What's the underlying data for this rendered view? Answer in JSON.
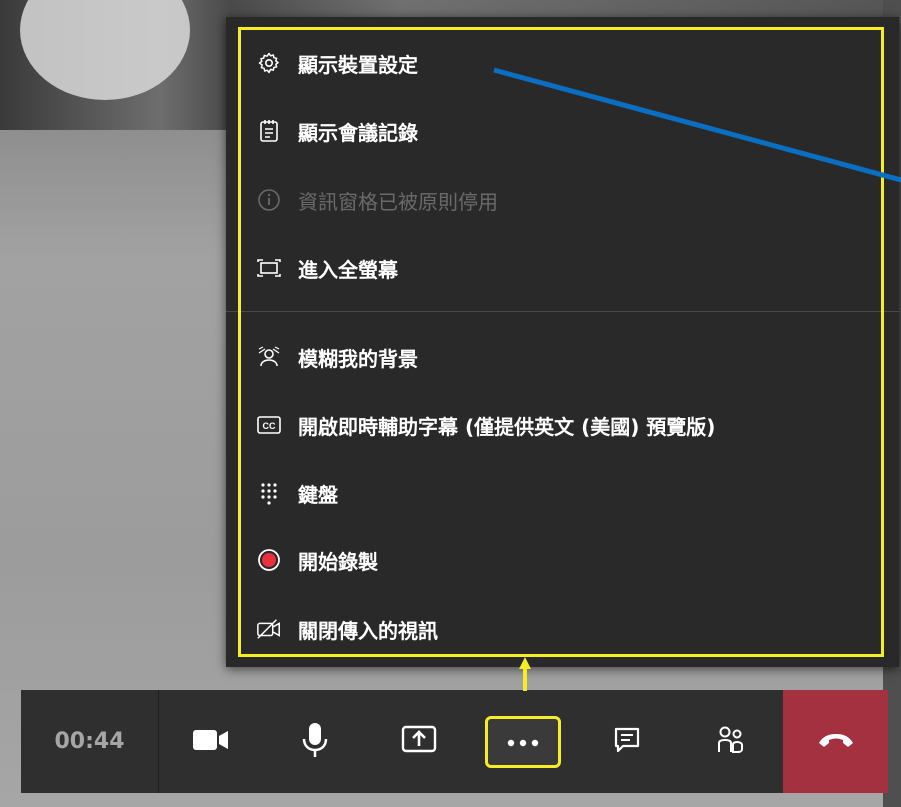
{
  "menu": {
    "items": [
      {
        "label": "顯示裝置設定",
        "icon": "gear-icon",
        "enabled": true
      },
      {
        "label": "顯示會議記錄",
        "icon": "notes-icon",
        "enabled": true
      },
      {
        "label": "資訊窗格已被原則停用",
        "icon": "info-icon",
        "enabled": false
      },
      {
        "label": "進入全螢幕",
        "icon": "fullscreen-icon",
        "enabled": true
      },
      {
        "label": "模糊我的背景",
        "icon": "blur-background-icon",
        "enabled": true
      },
      {
        "label": "開啟即時輔助字幕 (僅提供英文 (美國) 預覽版)",
        "icon": "closed-captions-icon",
        "enabled": true
      },
      {
        "label": "鍵盤",
        "icon": "keypad-icon",
        "enabled": true
      },
      {
        "label": "開始錄製",
        "icon": "record-icon",
        "enabled": true
      },
      {
        "label": "關閉傳入的視訊",
        "icon": "video-off-icon",
        "enabled": true
      }
    ]
  },
  "toolbar": {
    "timer": "00:44",
    "buttons": [
      "camera-icon",
      "microphone-icon",
      "share-screen-icon",
      "more-options-icon",
      "chat-icon",
      "participants-icon",
      "hang-up-icon"
    ]
  },
  "colors": {
    "menu_bg": "#292929",
    "highlight": "#f6ee24",
    "annotation": "#0a6fc2",
    "hangup": "#a4313f",
    "record": "#e8303f"
  }
}
